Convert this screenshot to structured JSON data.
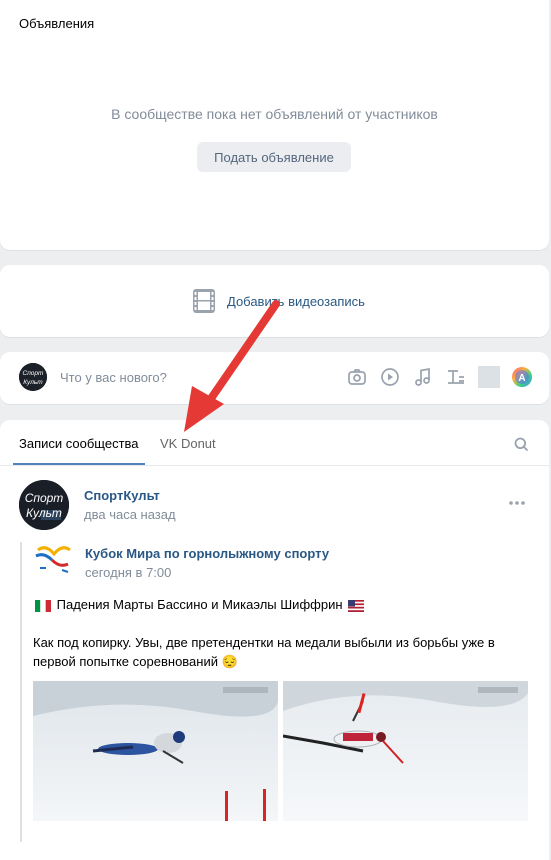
{
  "announcements": {
    "title": "Объявления",
    "empty_text": "В сообществе пока нет объявлений от участников",
    "button_label": "Подать объявление"
  },
  "video": {
    "add_label": "Добавить видеозапись"
  },
  "composer": {
    "placeholder": "Что у вас нового?"
  },
  "tabs": [
    {
      "label": "Записи сообщества",
      "active": true
    },
    {
      "label": "VK Donut",
      "active": false
    }
  ],
  "post": {
    "author": "СпортКульт",
    "time": "два часа назад",
    "repost": {
      "author": "Кубок Мира по горнолыжному спорту",
      "time": "сегодня в 7:00",
      "text_line1": "Падения Марты Бассино и Микаэлы Шиффрин",
      "text_line2": "Как под копирку. Увы, две претендентки на медали выбыли из борьбы уже в",
      "text_line3": "первой попытке соревнований 😔"
    }
  },
  "colors": {
    "accent": "#2a5885",
    "muted": "#818c99",
    "annotation_arrow": "#e53935"
  }
}
